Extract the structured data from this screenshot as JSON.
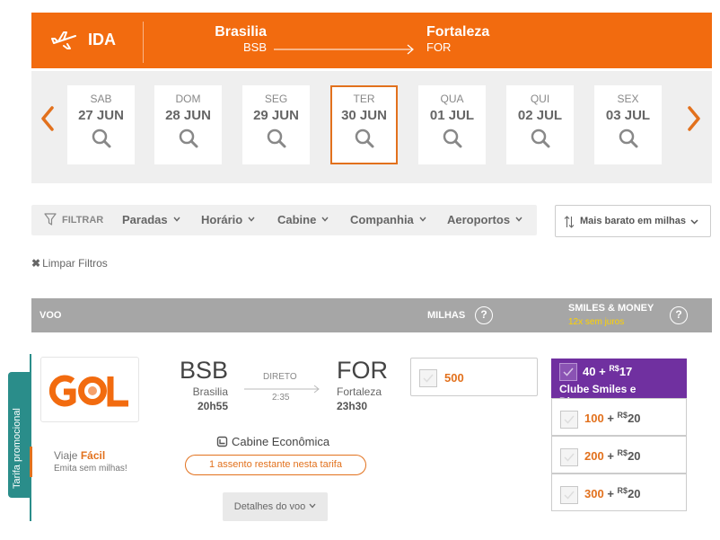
{
  "route": {
    "direction_label": "IDA",
    "origin_city": "Brasilia",
    "origin_code": "BSB",
    "destination_city": "Fortaleza",
    "destination_code": "FOR"
  },
  "dates": [
    {
      "dow": "SAB",
      "date": "27 JUN",
      "selected": false
    },
    {
      "dow": "DOM",
      "date": "28 JUN",
      "selected": false
    },
    {
      "dow": "SEG",
      "date": "29 JUN",
      "selected": false
    },
    {
      "dow": "TER",
      "date": "30 JUN",
      "selected": true
    },
    {
      "dow": "QUA",
      "date": "01 JUL",
      "selected": false
    },
    {
      "dow": "QUI",
      "date": "02 JUL",
      "selected": false
    },
    {
      "dow": "SEX",
      "date": "03 JUL",
      "selected": false
    }
  ],
  "filters": {
    "filter_label": "FILTRAR",
    "items": [
      "Paradas",
      "Horário",
      "Cabine",
      "Companhia",
      "Aeroportos"
    ],
    "sort_label": "Mais barato em milhas",
    "clear_label": "Limpar Filtros"
  },
  "table_header": {
    "flight_col": "VOO",
    "miles_col": "MILHAS",
    "help_glyph": "?",
    "smiles_money_col": "SMILES & MONEY",
    "installments": "12x sem juros"
  },
  "flight": {
    "promo_tab": "Tarifa promocional",
    "airline_logo_text": "GOL",
    "viaje_prefix": "Viaje ",
    "viaje_facil": "Fácil",
    "emita_text": "Emita sem milhas!",
    "origin_code": "BSB",
    "origin_city": "Brasilia",
    "departure_time": "20h55",
    "stops_label": "DIRETO",
    "duration": "2:35",
    "dest_code": "FOR",
    "dest_city": "Fortaleza",
    "arrival_time": "23h30",
    "cabin": "Cabine Econômica",
    "seats_left": "1 assento restante nesta tarifa",
    "details_button": "Detalhes do voo",
    "miles_price": "500"
  },
  "smiles_money": {
    "featured": {
      "miles": "40",
      "plus": "+",
      "currency": "R$",
      "cash": "17",
      "club": "Clube Smiles e Diamante"
    },
    "options": [
      {
        "miles": "100",
        "plus": "+",
        "currency": "R$",
        "cash": "20"
      },
      {
        "miles": "200",
        "plus": "+",
        "currency": "R$",
        "cash": "20"
      },
      {
        "miles": "300",
        "plus": "+",
        "currency": "R$",
        "cash": "20"
      }
    ]
  },
  "colors": {
    "brand_orange": "#f26b0f",
    "smiles_purple": "#7030a0",
    "promo_teal": "#2a8d8a"
  }
}
